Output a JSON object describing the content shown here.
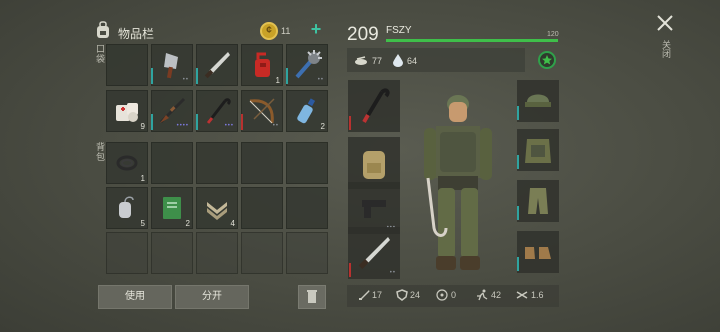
{
  "inventory": {
    "title": "物品栏",
    "coins": "11",
    "pocket_label": "口袋",
    "backpack_label": "背包",
    "pockets": [
      {
        "name": "cleaver-icon",
        "dur": "teal",
        "dots": "grey"
      },
      {
        "name": "machete-icon",
        "dur": "teal"
      },
      {
        "name": "gas-can-icon",
        "count": "1"
      },
      {
        "name": "spiked-mace-icon",
        "dur": "teal",
        "dots": "grey"
      },
      {
        "name": "bandage-icon",
        "count": "9"
      },
      {
        "name": "shotgun-icon",
        "dur": "teal",
        "dots": "purple"
      },
      {
        "name": "crowbar-icon",
        "dur": "teal",
        "dots": "purple"
      },
      {
        "name": "bow-icon",
        "dur": "red",
        "dots": "grey"
      },
      {
        "name": "water-bottle-icon",
        "count": "2"
      }
    ],
    "backpack": [
      {
        "name": "rope-icon",
        "count": "1"
      },
      {
        "name": "dog-tag-icon",
        "count": "5"
      },
      {
        "name": "notebook-icon",
        "count": "2"
      },
      {
        "name": "rank-badge-icon",
        "count": "4"
      }
    ],
    "use_label": "使用",
    "split_label": "分开"
  },
  "character": {
    "level": "209",
    "name": "FSZY",
    "xp_max": "120",
    "xp_fraction": 1.0,
    "food": "77",
    "water": "64",
    "close_label": "关闭"
  },
  "stats": {
    "attack": "17",
    "defense": "24",
    "radiation": "0",
    "speed": "42",
    "weight": "1.6"
  }
}
